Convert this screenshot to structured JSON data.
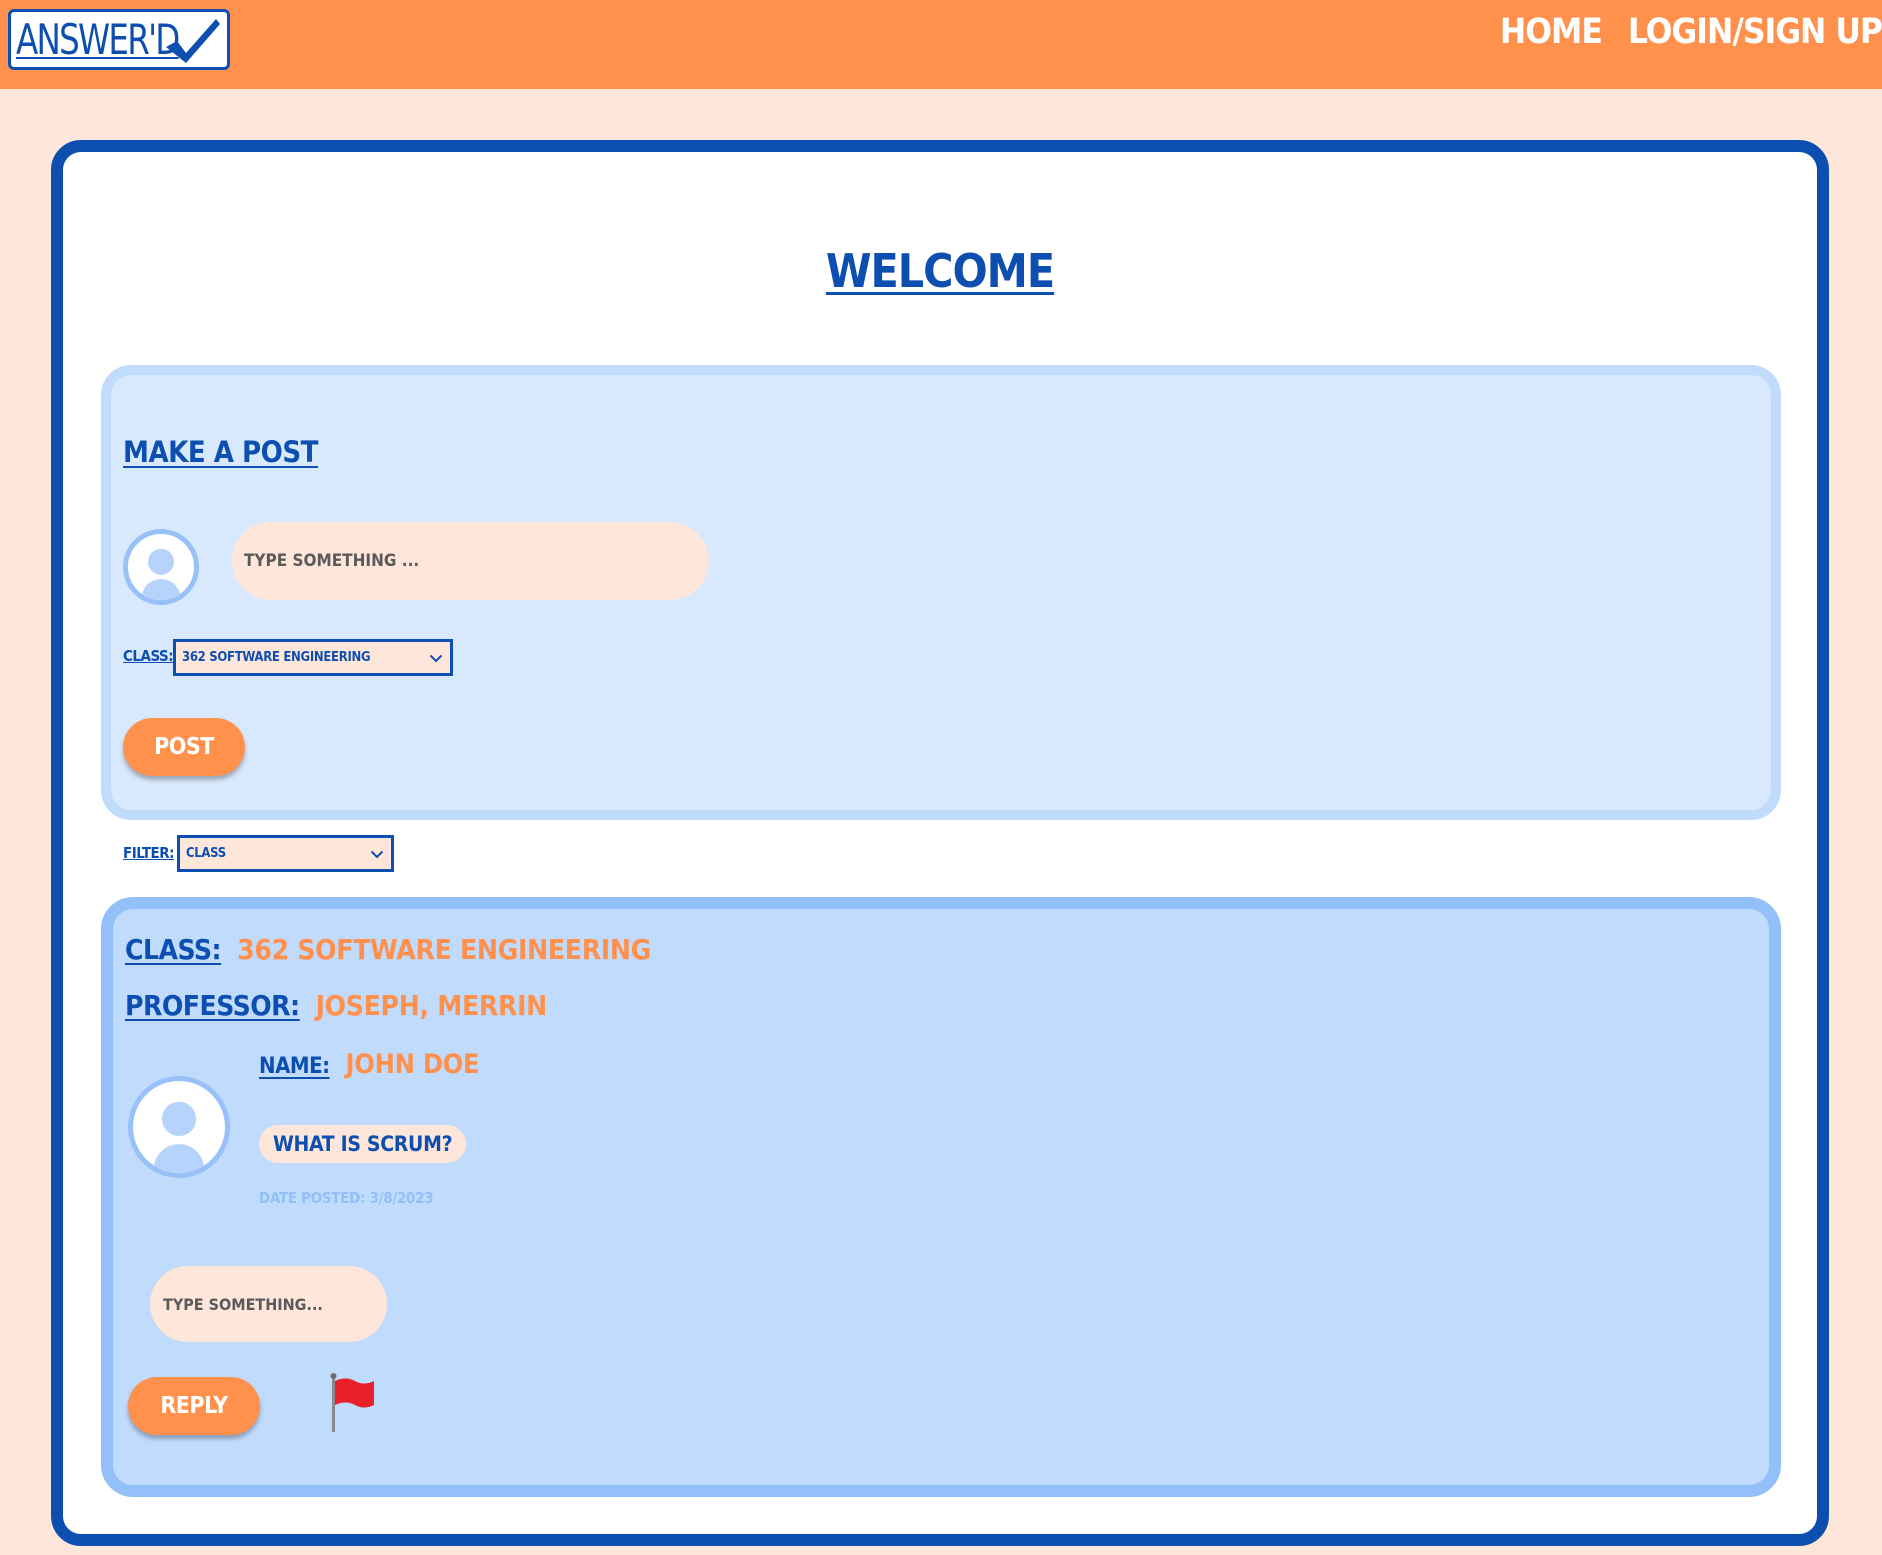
{
  "header": {
    "logo_text": "ANSWER'D",
    "nav": [
      {
        "label": "HOME"
      },
      {
        "label": "LOGIN/SIGN UP"
      }
    ]
  },
  "main": {
    "title": "WELCOME"
  },
  "make_post": {
    "title": "MAKE A POST",
    "input_placeholder": "TYPE SOMETHING ...",
    "class_label": "CLASS:",
    "class_selected": "362 SOFTWARE ENGINEERING",
    "post_button": "POST"
  },
  "filter": {
    "label": "FILTER:",
    "selected": "CLASS"
  },
  "feed": {
    "class_label": "CLASS:",
    "class_value": "362 SOFTWARE ENGINEERING",
    "professor_label": "PROFESSOR:",
    "professor_value": "JOSEPH, MERRIN",
    "name_label": "NAME:",
    "name_value": "JOHN DOE",
    "question": "WHAT IS SCRUM?",
    "date_posted": "DATE POSTED: 3/8/2023",
    "reply_placeholder": "TYPE SOMETHING...",
    "reply_button": "REPLY",
    "flag_icon": "red-flag-icon"
  },
  "colors": {
    "header_orange": "#ff914d",
    "page_bg": "#ffe6da",
    "brand_blue": "#0d4fb0",
    "panel_light_blue": "#d9e9fd",
    "panel_blue": "#c1dbfd",
    "panel_border_blue": "#93c0f8"
  }
}
